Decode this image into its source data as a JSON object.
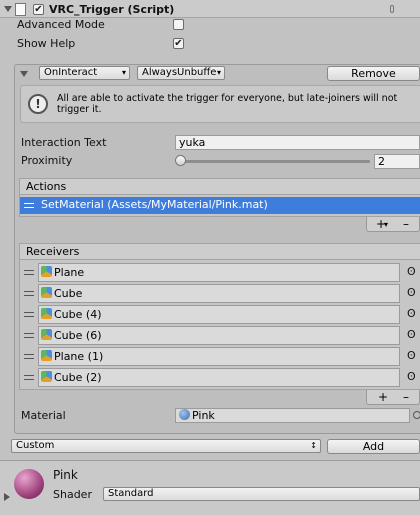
{
  "component": {
    "title": "VRC_Trigger (Script)"
  },
  "advanced_mode": {
    "label": "Advanced Mode",
    "checked": false
  },
  "show_help": {
    "label": "Show Help",
    "checked": true
  },
  "trigger": {
    "event_type": "OnInteract",
    "broadcast_type": "AlwaysUnbuffe",
    "remove_label": "Remove",
    "help_text_line1": "All are able to activate the trigger for everyone, but late-joiners will not",
    "help_text_line2": "trigger it.",
    "interaction_text": {
      "label": "Interaction Text",
      "value": "yuka"
    },
    "proximity": {
      "label": "Proximity",
      "value": "2",
      "fraction": 0
    },
    "actions": {
      "header": "Actions",
      "items": [
        "SetMaterial (Assets/MyMaterial/Pink.mat)"
      ],
      "add_symbol": "+",
      "dropdown_symbol": "▾",
      "remove_symbol": "–"
    },
    "receivers": {
      "header": "Receivers",
      "items": [
        {
          "name": "Plane",
          "icon": "cube-icon",
          "target": "ʘ"
        },
        {
          "name": "Cube",
          "icon": "cube-icon",
          "target": "ʘ"
        },
        {
          "name": "Cube (4)",
          "icon": "cube-icon",
          "target": "ʘ"
        },
        {
          "name": "Cube (6)",
          "icon": "cube-icon",
          "target": "ʘ"
        },
        {
          "name": "Plane (1)",
          "icon": "cube-icon",
          "target": "ʘ"
        },
        {
          "name": "Cube (2)",
          "icon": "cube-icon",
          "target": "ʘ"
        }
      ],
      "add_symbol": "+",
      "remove_symbol": "–"
    },
    "material": {
      "label": "Material",
      "value": "Pink"
    }
  },
  "bottom": {
    "custom_dropdown": "Custom",
    "add_label": "Add"
  },
  "material_preview": {
    "name": "Pink",
    "shader_label": "Shader",
    "shader_value": "Standard"
  },
  "colors": {
    "selected_row": "#3e7ddb",
    "panel_bg": "#c2c2c2"
  }
}
